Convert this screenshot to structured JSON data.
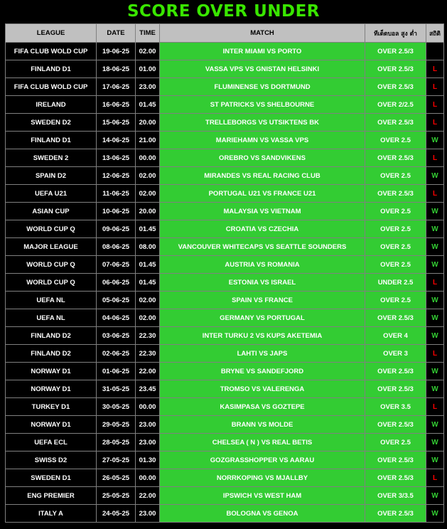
{
  "title": "SCORE OVER UNDER",
  "colors": {
    "title": "#39e600",
    "header_bg": "#c0c0c0",
    "cell_green": "#33cc33",
    "win": "#33cc33",
    "loss": "#ff0000"
  },
  "headers": {
    "league": "LEAGUE",
    "date": "DATE",
    "time": "TIME",
    "match": "MATCH",
    "pick": "ทีเด็ดบอล สูง ต่ำ",
    "result": "สถิติ"
  },
  "rows": [
    {
      "league": "FIFA CLUB WOLD CUP",
      "date": "19-06-25",
      "time": "02.00",
      "match": "INTER MIAMI VS PORTO",
      "pick": "OVER 2.5/3",
      "result": ""
    },
    {
      "league": "FINLAND D1",
      "date": "18-06-25",
      "time": "01.00",
      "match": "VASSA VPS VS GNISTAN HELSINKI",
      "pick": "OVER 2.5/3",
      "result": "L"
    },
    {
      "league": "FIFA CLUB WOLD CUP",
      "date": "17-06-25",
      "time": "23.00",
      "match": "FLUMINENSE VS DORTMUND",
      "pick": "OVER 2.5/3",
      "result": "L"
    },
    {
      "league": "IRELAND",
      "date": "16-06-25",
      "time": "01.45",
      "match": "ST PATRICKS VS SHELBOURNE",
      "pick": "OVER 2/2.5",
      "result": "L"
    },
    {
      "league": "SWEDEN D2",
      "date": "15-06-25",
      "time": "20.00",
      "match": "TRELLEBORGS VS UTSIKTENS BK",
      "pick": "OVER 2.5/3",
      "result": "L"
    },
    {
      "league": "FINLAND D1",
      "date": "14-06-25",
      "time": "21.00",
      "match": "MARIEHAMN VS VASSA VPS",
      "pick": "OVER 2.5",
      "result": "W"
    },
    {
      "league": "SWEDEN 2",
      "date": "13-06-25",
      "time": "00.00",
      "match": "OREBRO VS SANDVIKENS",
      "pick": "OVER 2.5/3",
      "result": "L"
    },
    {
      "league": "SPAIN D2",
      "date": "12-06-25",
      "time": "02.00",
      "match": "MIRANDES VS REAL RACING CLUB",
      "pick": "OVER 2.5",
      "result": "W"
    },
    {
      "league": "UEFA U21",
      "date": "11-06-25",
      "time": "02.00",
      "match": "PORTUGAL U21 VS FRANCE U21",
      "pick": "OVER 2.5/3",
      "result": "L"
    },
    {
      "league": "ASIAN CUP",
      "date": "10-06-25",
      "time": "20.00",
      "match": "MALAYSIA VS VIETNAM",
      "pick": "OVER 2.5",
      "result": "W"
    },
    {
      "league": "WORLD CUP Q",
      "date": "09-06-25",
      "time": "01.45",
      "match": "CROATIA VS CZECHIA",
      "pick": "OVER 2.5",
      "result": "W"
    },
    {
      "league": "MAJOR LEAGUE",
      "date": "08-06-25",
      "time": "08.00",
      "match": "VANCOUVER WHITECAPS VS SEATTLE SOUNDERS",
      "pick": "OVER 2.5",
      "result": "W"
    },
    {
      "league": "WORLD CUP Q",
      "date": "07-06-25",
      "time": "01.45",
      "match": "AUSTRIA VS ROMANIA",
      "pick": "OVER 2.5",
      "result": "W"
    },
    {
      "league": "WORLD CUP Q",
      "date": "06-06-25",
      "time": "01.45",
      "match": "ESTONIA VS ISRAEL",
      "pick": "UNDER 2.5",
      "result": "L"
    },
    {
      "league": "UEFA NL",
      "date": "05-06-25",
      "time": "02.00",
      "match": "SPAIN VS FRANCE",
      "pick": "OVER 2.5",
      "result": "W"
    },
    {
      "league": "UEFA NL",
      "date": "04-06-25",
      "time": "02.00",
      "match": "GERMANY VS PORTUGAL",
      "pick": "OVER 2.5/3",
      "result": "W"
    },
    {
      "league": "FINLAND D2",
      "date": "03-06-25",
      "time": "22.30",
      "match": "INTER TURKU 2 VS KUPS AKETEMIA",
      "pick": "OVER 4",
      "result": "W"
    },
    {
      "league": "FINLAND D2",
      "date": "02-06-25",
      "time": "22.30",
      "match": "LAHTI VS JAPS",
      "pick": "OVER 3",
      "result": "L"
    },
    {
      "league": "NORWAY D1",
      "date": "01-06-25",
      "time": "22.00",
      "match": "BRYNE VS SANDEFJORD",
      "pick": "OVER 2.5/3",
      "result": "W"
    },
    {
      "league": "NORWAY D1",
      "date": "31-05-25",
      "time": "23.45",
      "match": "TROMSO VS VALERENGA",
      "pick": "OVER 2.5/3",
      "result": "W"
    },
    {
      "league": "TURKEY D1",
      "date": "30-05-25",
      "time": "00.00",
      "match": "KASIMPASA VS GOZTEPE",
      "pick": "OVER 3.5",
      "result": "L"
    },
    {
      "league": "NORWAY D1",
      "date": "29-05-25",
      "time": "23.00",
      "match": "BRANN  VS MOLDE",
      "pick": "OVER 2.5/3",
      "result": "W"
    },
    {
      "league": "UEFA ECL",
      "date": "28-05-25",
      "time": "23.00",
      "match": "CHELSEA ( N ) VS REAL BETIS",
      "pick": "OVER 2.5",
      "result": "W"
    },
    {
      "league": "SWISS D2",
      "date": "27-05-25",
      "time": "01.30",
      "match": "GOZGRASSHOPPER VS AARAU",
      "pick": "OVER 2.5/3",
      "result": "W"
    },
    {
      "league": "SWEDEN D1",
      "date": "26-05-25",
      "time": "00.00",
      "match": "NORRKOPING VS MJALLBY",
      "pick": "OVER 2.5/3",
      "result": "L"
    },
    {
      "league": "ENG PREMIER",
      "date": "25-05-25",
      "time": "22.00",
      "match": "IPSWICH VS WEST HAM",
      "pick": "OVER 3/3.5",
      "result": "W"
    },
    {
      "league": "ITALY A",
      "date": "24-05-25",
      "time": "23.00",
      "match": "BOLOGNA VS GENOA",
      "pick": "OVER 2.5/3",
      "result": "W"
    }
  ]
}
